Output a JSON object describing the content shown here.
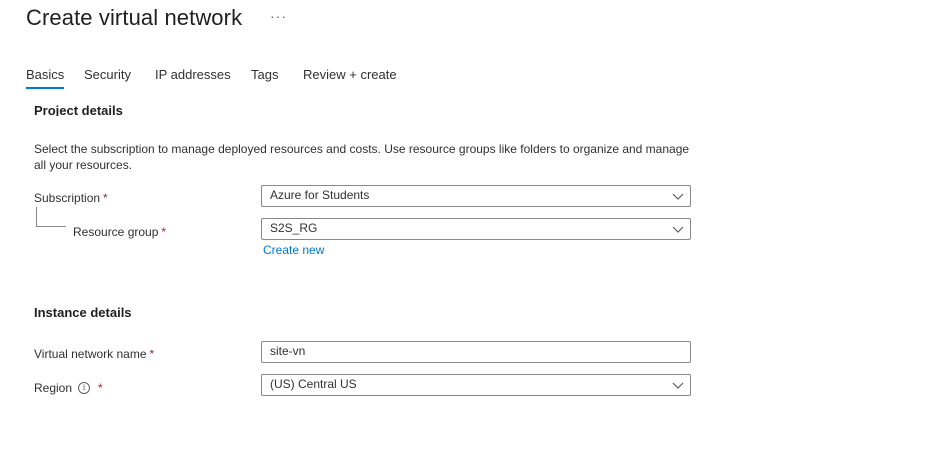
{
  "header": {
    "title": "Create virtual network",
    "more_label": "···"
  },
  "tabs": [
    {
      "label": "Basics",
      "active": true
    },
    {
      "label": "Security",
      "active": false
    },
    {
      "label": "IP addresses",
      "active": false
    },
    {
      "label": "Tags",
      "active": false
    },
    {
      "label": "Review + create",
      "active": false
    }
  ],
  "project_details": {
    "heading": "Project details",
    "description": "Select the subscription to manage deployed resources and costs. Use resource groups like folders to organize and manage all your resources.",
    "subscription": {
      "label": "Subscription",
      "required_mark": "*",
      "value": "Azure for Students"
    },
    "resource_group": {
      "label": "Resource group",
      "required_mark": "*",
      "value": "S2S_RG",
      "create_new_label": "Create new"
    }
  },
  "instance_details": {
    "heading": "Instance details",
    "vnet_name": {
      "label": "Virtual network name",
      "required_mark": "*",
      "value": "site-vn"
    },
    "region": {
      "label": "Region",
      "info_glyph": "i",
      "required_mark": "*",
      "value": "(US) Central US"
    }
  },
  "icons": {
    "dropdown": "chevron-down-icon",
    "info": "info-icon"
  },
  "colors": {
    "accent": "#0078d4",
    "required": "#a4262c",
    "border": "#8a8886"
  }
}
